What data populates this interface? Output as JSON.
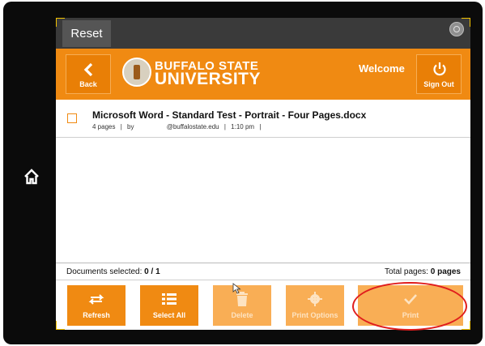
{
  "device": {
    "home_icon": "home-icon"
  },
  "topbar": {
    "reset_label": "Reset",
    "settings_icon": "settings-circle-icon"
  },
  "header": {
    "back_label": "Back",
    "logo_line1": "BUFFALO STATE",
    "logo_line2": "UNIVERSITY",
    "welcome_label": "Welcome",
    "signout_label": "Sign Out",
    "accent_color": "#f08a12"
  },
  "documents": [
    {
      "name": "Microsoft Word - Standard Test - Portrait - Four Pages.docx",
      "pages": "4 pages",
      "by": "by",
      "email": "@buffalostate.edu",
      "time": "1:10 pm",
      "selected": false
    }
  ],
  "status": {
    "selected_label": "Documents selected:",
    "selected_value": "0 / 1",
    "total_label": "Total pages:",
    "total_value": "0 pages"
  },
  "toolbar": {
    "refresh": {
      "label": "Refresh",
      "icon": "refresh-icon"
    },
    "select_all": {
      "label": "Select All",
      "icon": "list-icon"
    },
    "delete": {
      "label": "Delete",
      "icon": "trash-icon",
      "disabled": true
    },
    "print_options": {
      "label": "Print Options",
      "icon": "gear-icon",
      "disabled": true
    },
    "print": {
      "label": "Print",
      "icon": "checkmark-icon",
      "disabled": true
    }
  },
  "annotation_color": "#e01d1d"
}
